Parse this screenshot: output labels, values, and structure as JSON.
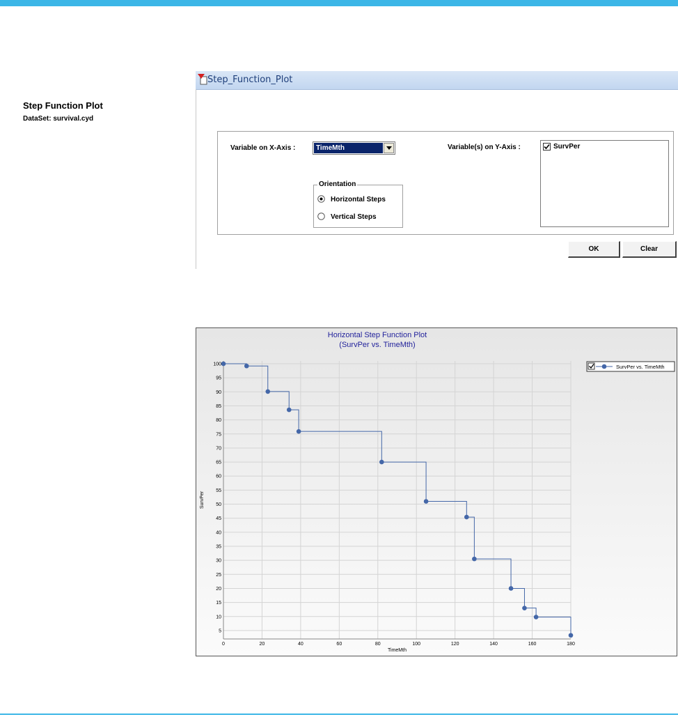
{
  "dialog": {
    "window_title": "Step_Function_Plot",
    "heading": "Step Function Plot",
    "dataset": "DataSet: survival.cyd",
    "x_axis_label": "Variable on X-Axis :",
    "x_axis_value": "TimeMth",
    "y_axis_label": "Variable(s) on Y-Axis :",
    "y_vars": [
      "SurvPer"
    ],
    "orientation": {
      "title": "Orientation",
      "options": [
        "Horizontal Steps",
        "Vertical Steps"
      ],
      "selected": "Horizontal Steps"
    },
    "ok_label": "OK",
    "clear_label": "Clear"
  },
  "chart_data": {
    "type": "line",
    "step": "horizontal",
    "title": "Horizontal Step Function Plot",
    "subtitle": "(SurvPer vs. TimeMth)",
    "xlabel": "TimeMth",
    "ylabel": "SurvPer",
    "xlim": [
      0,
      180
    ],
    "ylim": [
      2,
      101
    ],
    "xticks": [
      0,
      20,
      40,
      60,
      80,
      100,
      120,
      140,
      160,
      180
    ],
    "yticks": [
      5,
      10,
      15,
      20,
      25,
      30,
      35,
      40,
      45,
      50,
      55,
      60,
      65,
      70,
      75,
      80,
      85,
      90,
      95,
      100
    ],
    "grid": true,
    "legend": "top-right",
    "series": [
      {
        "name": "SurvPer vs. TimeMth",
        "color": "#4467a8",
        "x": [
          0,
          12,
          23,
          34,
          39,
          82,
          105,
          126,
          130,
          149,
          156,
          162,
          180
        ],
        "y": [
          100,
          99.2,
          90.1,
          83.6,
          75.9,
          65,
          51,
          45.4,
          30.5,
          20,
          13,
          9.8,
          3.3
        ]
      }
    ]
  }
}
